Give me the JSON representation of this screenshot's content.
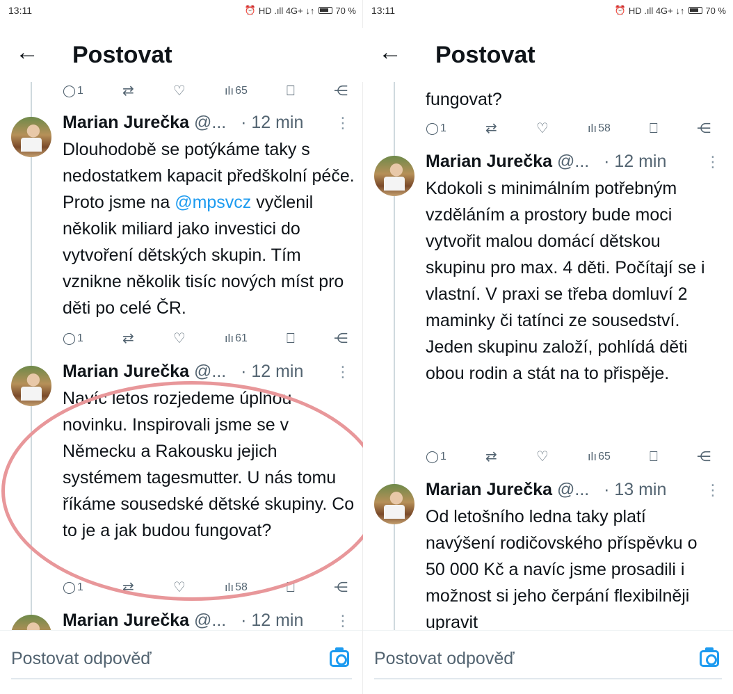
{
  "left": {
    "status": {
      "time": "13:11",
      "indicators": "HD .ıll 4G+ ↓↑",
      "battery": "70 %"
    },
    "header": {
      "title": "Postovat"
    },
    "top_actions": {
      "replies": "1",
      "views": "65"
    },
    "tweets": [
      {
        "name": "Marian Jurečka",
        "handle": "@...",
        "dot": "·",
        "time": "12 min",
        "text_before": "Dlouhodobě se potýkáme taky s nedostatkem kapacit předškolní péče. Proto jsme na ",
        "mention": "@mpsvcz",
        "text_after": " vyčlenil několik miliard jako investici do vytvoření dětských skupin. Tím vznikne několik tisíc nových míst pro děti po celé ČR.",
        "replies": "1",
        "views": "61"
      },
      {
        "name": "Marian Jurečka",
        "handle": "@...",
        "dot": "·",
        "time": "12 min",
        "text": "Navíc letos rozjedeme úplnou novinku. Inspirovali jsme se v Německu a Rakousku jejich systémem tagesmutter. U nás tomu říkáme sousedské dětské skupiny. Co to je a jak budou fungovat?",
        "replies": "1",
        "views": "58"
      },
      {
        "name": "Marian Jurečka",
        "handle": "@...",
        "dot": "·",
        "time": "12 min"
      }
    ],
    "reply_placeholder": "Postovat odpověď"
  },
  "right": {
    "status": {
      "time": "13:11",
      "indicators": "HD .ıll 4G+ ↓↑",
      "battery": "70 %"
    },
    "header": {
      "title": "Postovat"
    },
    "top_text": "fungovat?",
    "top_actions": {
      "replies": "1",
      "views": "58"
    },
    "tweets": [
      {
        "name": "Marian Jurečka",
        "handle": "@...",
        "dot": "·",
        "time": "12 min",
        "text": "Kdokoli s minimálním potřebným vzděláním a prostory bude moci vytvořit malou domácí dětskou skupinu pro max. 4 děti. Počítají se i vlastní. V praxi se třeba domluví 2 maminky či tatínci ze sousedství. Jeden skupinu založí, pohlídá děti obou rodin a stát na to přispěje.",
        "replies": "1",
        "views": "65"
      },
      {
        "name": "Marian Jurečka",
        "handle": "@...",
        "dot": "·",
        "time": "13 min",
        "text": "Od letošního ledna taky platí navýšení rodičovského příspěvku o 50 000 Kč a navíc jsme prosadili i možnost si jeho čerpání flexibilněji upravit"
      }
    ],
    "reply_placeholder": "Postovat odpověď"
  },
  "icons": {
    "back": "←",
    "reply": "◯",
    "retweet": "⇄",
    "like": "♡",
    "views": "ılı",
    "bookmark": "⎕",
    "share": "⋲",
    "more": "⋮",
    "alarm": "⏰"
  },
  "colors": {
    "accent": "#1d9bf0",
    "annotation": "#e8979a",
    "muted": "#536471"
  }
}
